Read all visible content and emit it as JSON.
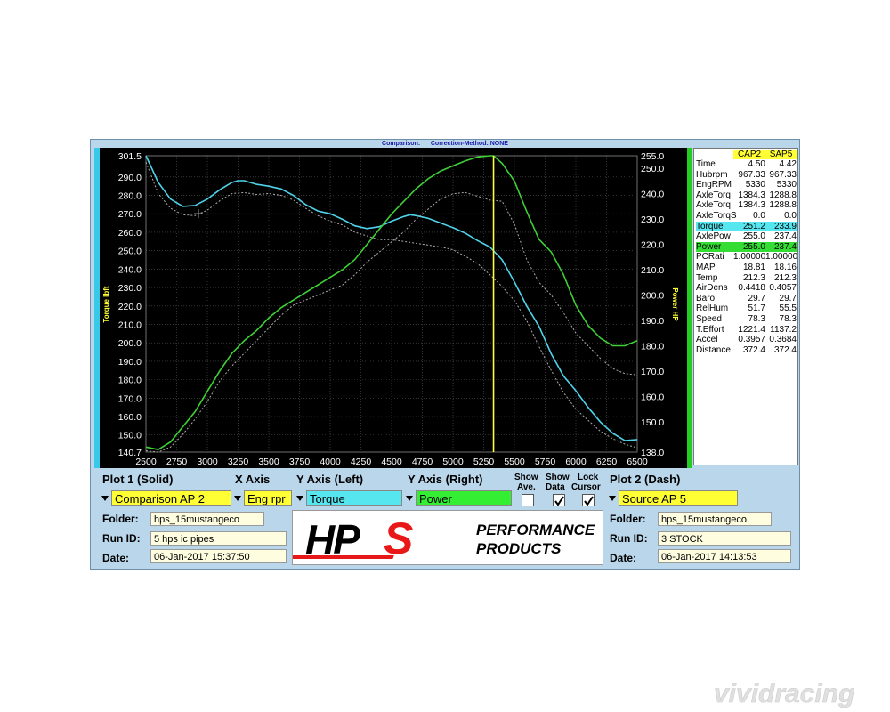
{
  "header": {
    "comparison_label": "Comparison:",
    "correction_label": "Correction-Method: NONE"
  },
  "colors": {
    "background": "#b9d6ea",
    "plot_bg": "#000000",
    "torque_solid": "#4fd3ea",
    "power_solid": "#3ed035",
    "dashed": "#aaaaaa",
    "cursor": "#ffff33",
    "left_bar": "#38c8e8",
    "right_bar": "#22cc22",
    "field_yellow": "#ffff33",
    "field_cyan": "#55e6f0",
    "field_green": "#33ee33"
  },
  "chart_data": {
    "type": "line",
    "xlabel": "",
    "ylabel_left": "Torque lbft",
    "ylabel_right": "Power HP",
    "xlim": [
      2500,
      6500
    ],
    "ylim_left": [
      140.7,
      301.5
    ],
    "ylim_right": [
      138.0,
      255.0
    ],
    "x_ticks": [
      "2500",
      "2750",
      "3000",
      "3250",
      "3500",
      "3750",
      "4000",
      "4250",
      "4500",
      "4750",
      "5000",
      "5250",
      "5500",
      "5750",
      "6000",
      "6250",
      "6500"
    ],
    "y_left_ticks": [
      "301.5",
      "290.0",
      "280.0",
      "270.0",
      "260.0",
      "250.0",
      "240.0",
      "230.0",
      "220.0",
      "210.0",
      "200.0",
      "190.0",
      "180.0",
      "170.0",
      "160.0",
      "150.0",
      "140.7"
    ],
    "y_right_ticks": [
      "255.0",
      "250.0",
      "240.0",
      "230.0",
      "220.0",
      "210.0",
      "200.0",
      "190.0",
      "180.0",
      "170.0",
      "160.0",
      "150.0",
      "138.0"
    ],
    "grid": true,
    "cursor_rpm": 5330,
    "series": [
      {
        "name": "Torque",
        "axis": "left",
        "style": "solid",
        "x": [
          2500,
          2600,
          2700,
          2800,
          2900,
          3000,
          3100,
          3200,
          3250,
          3300,
          3400,
          3500,
          3600,
          3700,
          3800,
          3900,
          4000,
          4100,
          4200,
          4300,
          4400,
          4500,
          4600,
          4650,
          4700,
          4800,
          4900,
          5000,
          5100,
          5200,
          5300,
          5400,
          5500,
          5600,
          5700,
          5800,
          5900,
          6000,
          6100,
          6200,
          6300,
          6400,
          6500
        ],
        "y": [
          301.5,
          287.0,
          278.0,
          274.0,
          274.5,
          278.0,
          283.0,
          287.0,
          288.0,
          288.0,
          286.0,
          285.0,
          283.5,
          280.0,
          275.0,
          271.5,
          270.0,
          267.0,
          263.5,
          262.0,
          263.0,
          266.0,
          268.5,
          269.5,
          269.0,
          267.5,
          265.0,
          262.5,
          259.5,
          255.5,
          252.0,
          245.0,
          233.0,
          220.0,
          209.0,
          194.0,
          182.0,
          174.0,
          165.0,
          157.0,
          151.0,
          147.0,
          147.5
        ]
      },
      {
        "name": "Torque",
        "axis": "left",
        "style": "dashed",
        "x": [
          2500,
          2600,
          2700,
          2800,
          2900,
          3000,
          3100,
          3200,
          3300,
          3400,
          3500,
          3600,
          3700,
          3800,
          3900,
          4000,
          4100,
          4200,
          4300,
          4400,
          4500,
          4600,
          4700,
          4800,
          4900,
          5000,
          5100,
          5200,
          5300,
          5400,
          5500,
          5600,
          5700,
          5800,
          5900,
          6000,
          6100,
          6200,
          6300,
          6400,
          6500
        ],
        "y": [
          298.0,
          281.0,
          273.0,
          269.5,
          269.0,
          272.0,
          277.0,
          281.0,
          281.5,
          280.5,
          281.0,
          280.0,
          277.5,
          273.0,
          269.0,
          266.0,
          264.0,
          260.0,
          258.0,
          256.0,
          256.0,
          255.0,
          254.0,
          253.0,
          252.0,
          250.5,
          247.0,
          243.0,
          237.0,
          230.5,
          223.0,
          212.0,
          198.0,
          185.0,
          173.0,
          164.0,
          158.0,
          152.0,
          148.0,
          145.0,
          143.0
        ]
      },
      {
        "name": "Power",
        "axis": "right",
        "style": "solid",
        "x": [
          2500,
          2600,
          2700,
          2800,
          2900,
          3000,
          3100,
          3200,
          3300,
          3400,
          3500,
          3600,
          3700,
          3800,
          3900,
          4000,
          4100,
          4200,
          4300,
          4400,
          4500,
          4600,
          4700,
          4800,
          4900,
          5000,
          5100,
          5200,
          5300,
          5330,
          5400,
          5500,
          5600,
          5700,
          5800,
          5900,
          6000,
          6100,
          6200,
          6300,
          6400,
          6500
        ],
        "y": [
          140.0,
          139.0,
          142.0,
          148.0,
          154.0,
          162.0,
          170.0,
          177.0,
          182.0,
          186.0,
          191.0,
          195.0,
          198.0,
          201.0,
          204.0,
          207.0,
          210.0,
          214.0,
          220.0,
          226.0,
          232.0,
          237.0,
          242.0,
          246.0,
          249.0,
          251.0,
          253.0,
          254.5,
          255.0,
          255.0,
          252.0,
          245.0,
          233.0,
          222.0,
          217.0,
          208.0,
          196.0,
          188.0,
          183.0,
          180.0,
          180.0,
          182.0
        ]
      },
      {
        "name": "Power",
        "axis": "right",
        "style": "dashed",
        "x": [
          2500,
          2600,
          2700,
          2800,
          2900,
          3000,
          3100,
          3200,
          3300,
          3400,
          3500,
          3600,
          3700,
          3800,
          3900,
          4000,
          4100,
          4200,
          4300,
          4400,
          4500,
          4600,
          4700,
          4800,
          4900,
          5000,
          5100,
          5200,
          5300,
          5400,
          5500,
          5600,
          5700,
          5800,
          5900,
          6000,
          6100,
          6200,
          6300,
          6400,
          6500
        ],
        "y": [
          138.5,
          138.0,
          140.0,
          145.0,
          151.0,
          158.0,
          166.0,
          172.0,
          177.0,
          182.0,
          187.0,
          192.0,
          196.0,
          198.0,
          200.0,
          202.0,
          204.0,
          208.0,
          213.0,
          217.0,
          221.0,
          225.0,
          230.0,
          234.0,
          238.0,
          240.0,
          240.5,
          239.0,
          237.5,
          237.0,
          228.0,
          214.0,
          205.0,
          200.0,
          193.0,
          185.0,
          180.0,
          175.0,
          171.0,
          169.0,
          168.5
        ]
      }
    ]
  },
  "data_panel": {
    "col1_header": "CAP2",
    "col2_header": "SAP5",
    "rows": [
      {
        "label": "Time",
        "v1": "4.50",
        "v2": "4.42",
        "hl": ""
      },
      {
        "label": "Hubrpm",
        "v1": "967.33",
        "v2": "967.33",
        "hl": ""
      },
      {
        "label": "EngRPM",
        "v1": "5330",
        "v2": "5330",
        "hl": ""
      },
      {
        "label": "AxleTorq",
        "v1": "1384.3",
        "v2": "1288.8",
        "hl": ""
      },
      {
        "label": "AxleTorq",
        "v1": "1384.3",
        "v2": "1288.8",
        "hl": ""
      },
      {
        "label": "AxleTorqS",
        "v1": "0.0",
        "v2": "0.0",
        "hl": ""
      },
      {
        "label": "Torque",
        "v1": "251.2",
        "v2": "233.9",
        "hl": "cyan"
      },
      {
        "label": "AxlePow",
        "v1": "255.0",
        "v2": "237.4",
        "hl": ""
      },
      {
        "label": "Power",
        "v1": "255.0",
        "v2": "237.4",
        "hl": "green"
      },
      {
        "label": "PCRati",
        "v1": "1.00000",
        "v2": "1.00000",
        "hl": ""
      },
      {
        "label": "MAP",
        "v1": "18.81",
        "v2": "18.16",
        "hl": ""
      },
      {
        "label": "Temp",
        "v1": "212.3",
        "v2": "212.3",
        "hl": ""
      },
      {
        "label": "AirDens",
        "v1": "0.4418",
        "v2": "0.4057",
        "hl": ""
      },
      {
        "label": "Baro",
        "v1": "29.7",
        "v2": "29.7",
        "hl": ""
      },
      {
        "label": "RelHum",
        "v1": "51.7",
        "v2": "55.5",
        "hl": ""
      },
      {
        "label": "Speed",
        "v1": "78.3",
        "v2": "78.3",
        "hl": ""
      },
      {
        "label": "T.Effort",
        "v1": "1221.4",
        "v2": "1137.2",
        "hl": ""
      },
      {
        "label": "Accel",
        "v1": "0.3957",
        "v2": "0.3684",
        "hl": ""
      },
      {
        "label": "Distance",
        "v1": "372.4",
        "v2": "372.4",
        "hl": ""
      }
    ]
  },
  "controls": {
    "plot1_title": "Plot 1 (Solid)",
    "plot1_value": "Comparison AP 2",
    "xaxis_title": "X Axis",
    "xaxis_value": "Eng rpr",
    "yleft_title": "Y Axis (Left)",
    "yleft_value": "Torque",
    "yright_title": "Y Axis (Right)",
    "yright_value": "Power",
    "show_ave_label_1": "Show",
    "show_ave_label_2": "Ave.",
    "show_data_label_1": "Show",
    "show_data_label_2": "Data",
    "lock_cursor_label_1": "Lock",
    "lock_cursor_label_2": "Cursor",
    "plot2_title": "Plot 2 (Dash)",
    "plot2_value": "Source AP 5"
  },
  "run_left": {
    "folder_label": "Folder:",
    "folder_value": "hps_15mustangeco",
    "runid_label": "Run ID:",
    "runid_value": "5 hps ic pipes",
    "date_label": "Date:",
    "date_value": "06-Jan-2017  15:37:50"
  },
  "run_right": {
    "folder_label": "Folder:",
    "folder_value": "hps_15mustangeco",
    "runid_label": "Run ID:",
    "runid_value": "3 STOCK",
    "date_label": "Date:",
    "date_value": "06-Jan-2017  14:13:53"
  },
  "logo": {
    "brand": "HPS",
    "tagline_1": "PERFORMANCE",
    "tagline_2": "PRODUCTS"
  },
  "watermark": {
    "text": "vividracing"
  }
}
